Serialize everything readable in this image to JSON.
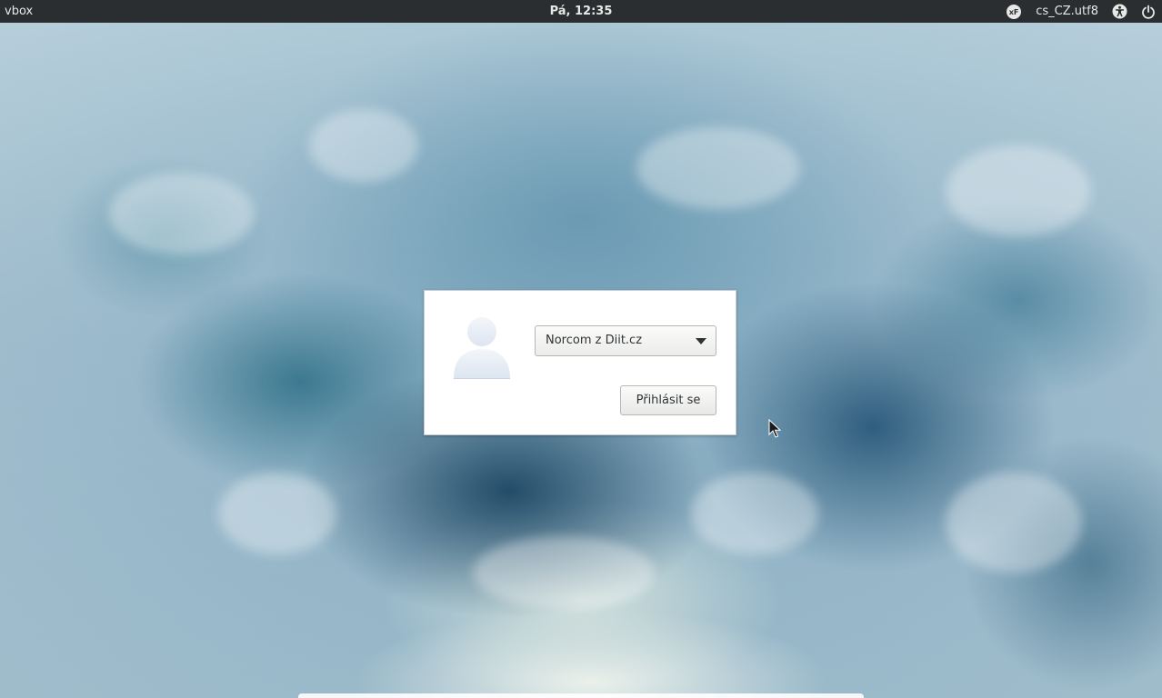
{
  "topbar": {
    "host": "vbox",
    "clock": "Pá, 12:35",
    "locale": "cs_CZ.utf8",
    "icons": {
      "keyboard": "keyboard-layout-icon",
      "accessibility": "accessibility-icon",
      "power": "power-icon"
    }
  },
  "login": {
    "selected_user": "Norcom z Diit.cz",
    "login_label": "Přihlásit se",
    "avatar_icon": "user-avatar-icon"
  },
  "colors": {
    "topbar_bg": "#2b2e30",
    "dialog_bg": "#ffffff",
    "text": "#2e3436"
  }
}
